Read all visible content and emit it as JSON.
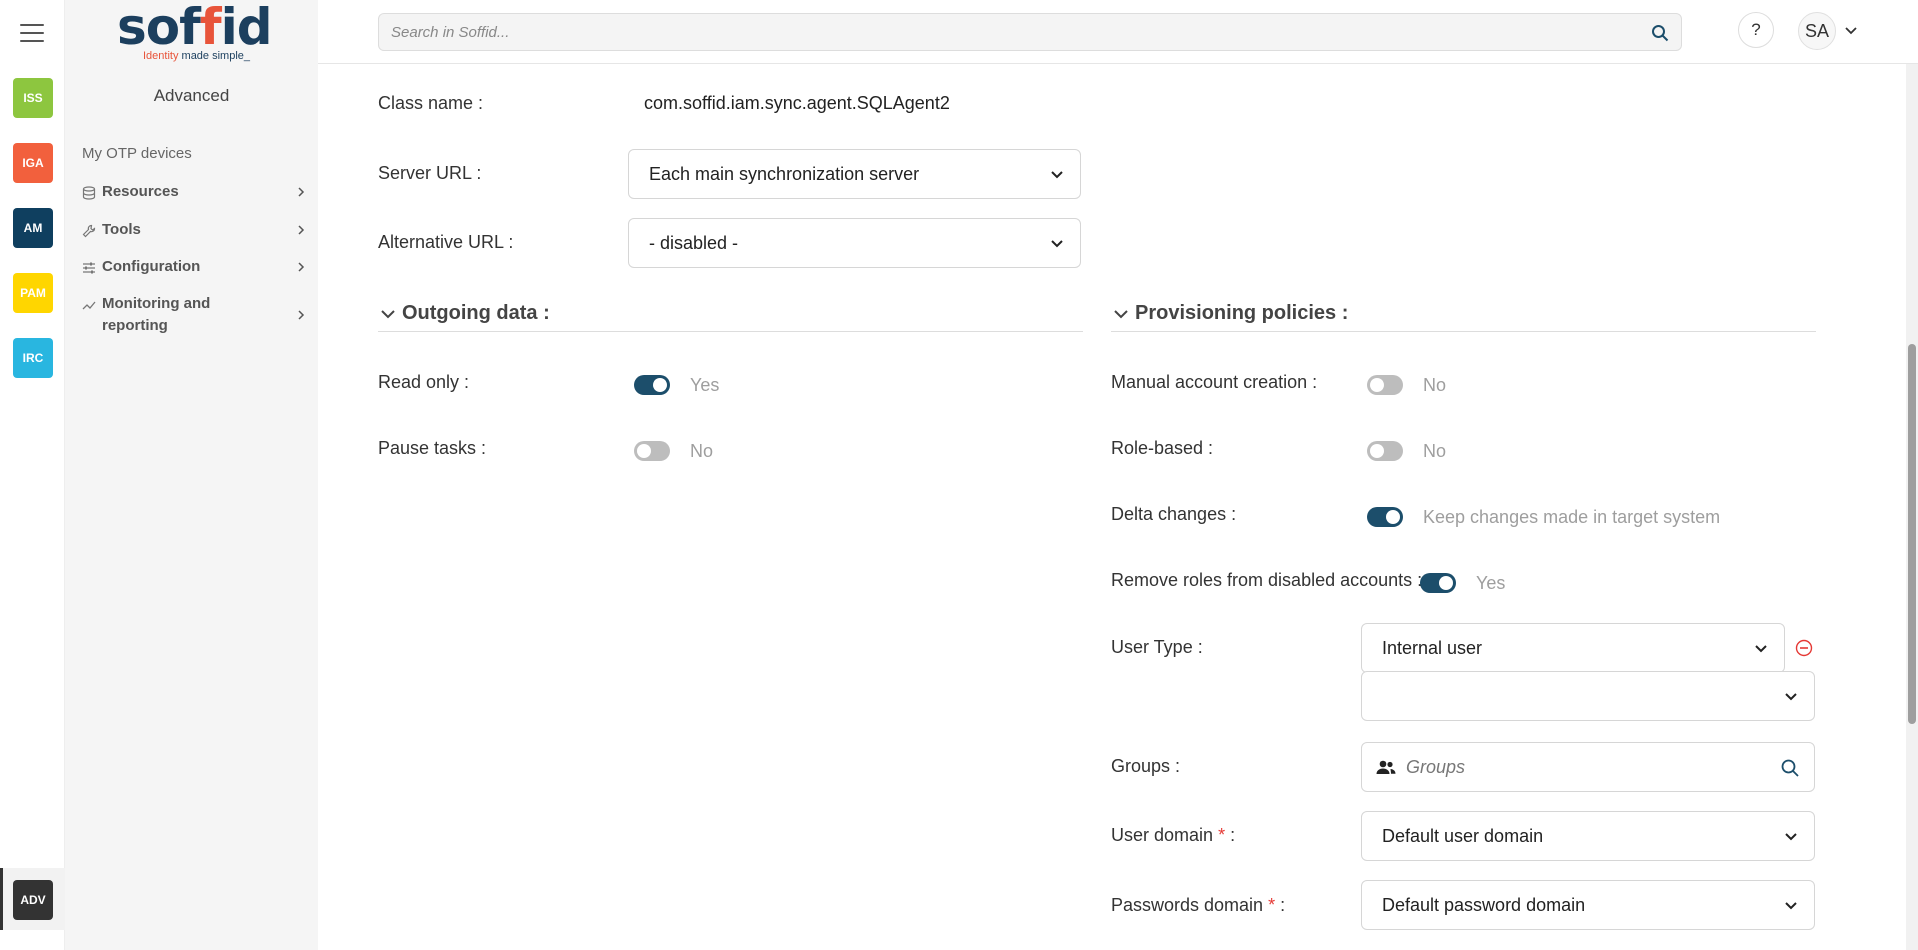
{
  "rail": {
    "apps": [
      {
        "label": "ISS",
        "color": "#8dc63f"
      },
      {
        "label": "IGA",
        "color": "#f2603d"
      },
      {
        "label": "AM",
        "color": "#0f3f5f"
      },
      {
        "label": "PAM",
        "color": "#ffd600"
      },
      {
        "label": "IRC",
        "color": "#29b6e0"
      }
    ],
    "active_app": {
      "label": "ADV",
      "color": "#333333"
    }
  },
  "logo": {
    "brand": "soffid",
    "tagline_accent": "Identity",
    "tagline_rest": "made simple_"
  },
  "sidebar": {
    "section_title": "Advanced",
    "plain_item": "My OTP devices",
    "items": [
      {
        "label": "Resources",
        "icon": "database-icon"
      },
      {
        "label": "Tools",
        "icon": "wrench-icon"
      },
      {
        "label": "Configuration",
        "icon": "sliders-icon"
      },
      {
        "label": "Monitoring and reporting",
        "icon": "chart-line-icon"
      }
    ]
  },
  "topbar": {
    "search_placeholder": "Search in Soffid...",
    "help_label": "?",
    "user_initials": "SA"
  },
  "form": {
    "class_name_label": "Class name :",
    "class_name_value": "com.soffid.iam.sync.agent.SQLAgent2",
    "server_url_label": "Server URL :",
    "server_url_value": "Each main synchronization server",
    "alt_url_label": "Alternative URL :",
    "alt_url_value": "- disabled -"
  },
  "outgoing": {
    "title": "Outgoing data :",
    "read_only_label": "Read only :",
    "read_only_on": true,
    "read_only_text": "Yes",
    "pause_label": "Pause tasks :",
    "pause_on": false,
    "pause_text": "No"
  },
  "provisioning": {
    "title": "Provisioning policies :",
    "manual_label": "Manual account creation :",
    "manual_on": false,
    "manual_text": "No",
    "role_label": "Role-based :",
    "role_on": false,
    "role_text": "No",
    "delta_label": "Delta changes :",
    "delta_on": true,
    "delta_text": "Keep changes made in target system",
    "remove_label": "Remove roles from disabled accounts :",
    "remove_on": true,
    "remove_text": "Yes",
    "user_type_label": "User Type :",
    "user_type_value": "Internal user",
    "user_type_extra_value": "",
    "groups_label": "Groups :",
    "groups_placeholder": "Groups",
    "user_domain_label": "User domain",
    "user_domain_value": "Default user domain",
    "pwd_domain_label": "Passwords domain",
    "pwd_domain_value": "Default password domain",
    "required_mark": "*",
    "colon": ":"
  }
}
